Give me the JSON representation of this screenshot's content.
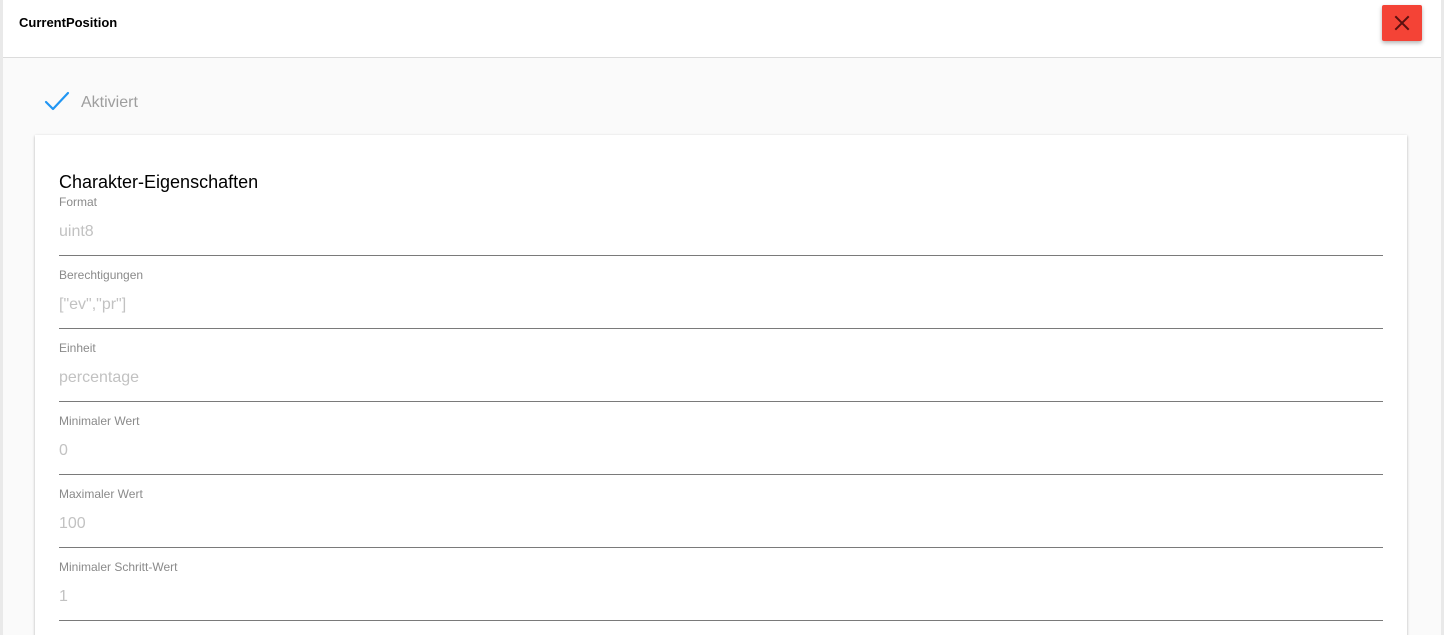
{
  "header": {
    "title": "CurrentPosition"
  },
  "status": {
    "enabled_label": "Aktiviert",
    "check_color": "#2196f3"
  },
  "close_button": {
    "icon": "close-icon",
    "color": "#f44336"
  },
  "card": {
    "title": "Charakter-Eigenschaften",
    "fields": [
      {
        "label": "Format",
        "value": "uint8"
      },
      {
        "label": "Berechtigungen",
        "value": "[\"ev\",\"pr\"]"
      },
      {
        "label": "Einheit",
        "value": "percentage"
      },
      {
        "label": "Minimaler Wert",
        "value": "0"
      },
      {
        "label": "Maximaler Wert",
        "value": "100"
      },
      {
        "label": "Minimaler Schritt-Wert",
        "value": "1"
      }
    ]
  }
}
